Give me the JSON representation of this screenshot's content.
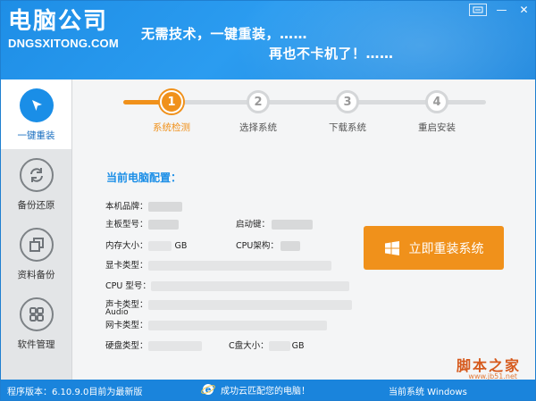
{
  "app": {
    "logo_cn": "电脑公司",
    "logo_en": "DNGSXITONG.COM",
    "slogan_1": "无需技术，一键重装，……",
    "slogan_2": "再也不卡机了！……"
  },
  "window_buttons": {
    "menu_icon": "menu-icon",
    "minimize": "—",
    "close": "✕"
  },
  "sidebar": {
    "items": [
      {
        "label": "一键重装",
        "icon": "cursor-icon",
        "active": true
      },
      {
        "label": "备份还原",
        "icon": "refresh-icon",
        "active": false
      },
      {
        "label": "资料备份",
        "icon": "copy-icon",
        "active": false
      },
      {
        "label": "软件管理",
        "icon": "grid-icon",
        "active": false
      }
    ]
  },
  "steps": [
    {
      "number": "1",
      "label": "系统检测",
      "active": true
    },
    {
      "number": "2",
      "label": "选择系统",
      "active": false
    },
    {
      "number": "3",
      "label": "下载系统",
      "active": false
    },
    {
      "number": "4",
      "label": "重启安装",
      "active": false
    }
  ],
  "config": {
    "title": "当前电脑配置：",
    "brand_label": "本机品牌：",
    "board_label": "主板型号：",
    "boot_key_label": "启动键：",
    "memory_label": "内存大小：",
    "memory_unit": "GB",
    "cpu_arch_label": "CPU架构：",
    "gpu_label": "显卡类型：",
    "cpu_label": "CPU 型号：",
    "sound_label": "声卡类型：",
    "sound_sub": "Audio",
    "nic_label": "网卡类型：",
    "disk_label": "硬盘类型：",
    "c_drive_label": "C盘大小：",
    "c_drive_unit": "GB"
  },
  "install_button": {
    "label": "立即重装系统",
    "icon": "windows-icon"
  },
  "status": {
    "version": "程序版本：6.10.9.0目前为最新版",
    "cloud_match": "成功云匹配您的电脑！",
    "current_system": "当前系统 Windows",
    "cloud_icon": "ie-icon"
  },
  "watermark": {
    "text": "脚本之家",
    "sub": "www.jb51.net"
  },
  "colors": {
    "primary": "#1a8ee7",
    "accent": "#f0911b",
    "statusbar": "#1a84dc"
  }
}
